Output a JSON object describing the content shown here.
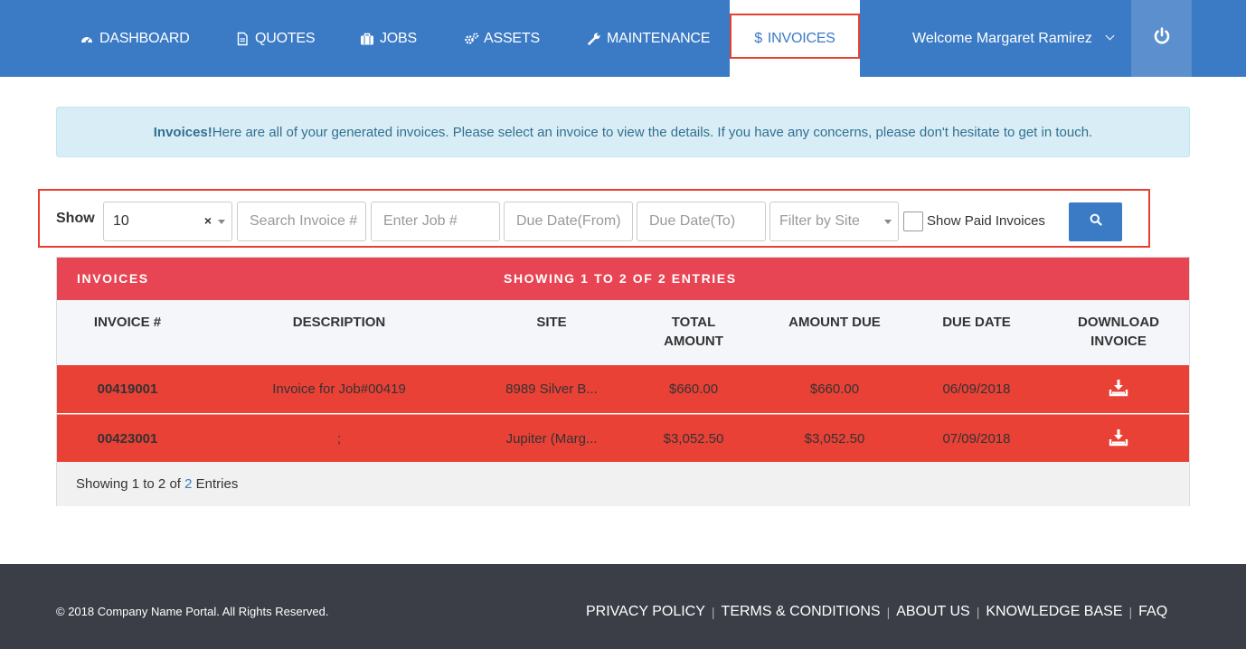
{
  "nav": {
    "items": [
      {
        "label": "DASHBOARD",
        "icon": "dashboard-icon"
      },
      {
        "label": "QUOTES",
        "icon": "file-icon"
      },
      {
        "label": "JOBS",
        "icon": "briefcase-icon"
      },
      {
        "label": "ASSETS",
        "icon": "cogs-icon"
      },
      {
        "label": "MAINTENANCE",
        "icon": "wrench-icon"
      },
      {
        "label": "INVOICES",
        "icon": "dollar-icon",
        "active": true
      }
    ],
    "welcome": "Welcome Margaret Ramirez",
    "power_icon": "power-icon"
  },
  "alert": {
    "bold": "Invoices!",
    "text": "Here are all of your generated invoices. Please select an invoice to view the details. If you have any concerns, please don't hesitate to get in touch."
  },
  "filters": {
    "show_label": "Show",
    "page_length": "10",
    "clear_symbol": "×",
    "search_invoice_placeholder": "Search Invoice #",
    "job_placeholder": "Enter Job #",
    "due_from_placeholder": "Due Date(From)",
    "due_to_placeholder": "Due Date(To)",
    "site_placeholder": "Filter by Site",
    "show_paid_label": "Show Paid Invoices",
    "show_paid_checked": false
  },
  "table": {
    "title": "INVOICES",
    "showing_header": "SHOWING 1 TO 2 OF 2 ENTRIES",
    "columns": {
      "invoice": "INVOICE #",
      "description": "DESCRIPTION",
      "site": "SITE",
      "total_line1": "TOTAL",
      "total_line2": "AMOUNT",
      "amount_due": "AMOUNT DUE",
      "due_date": "DUE DATE",
      "download_line1": "DOWNLOAD",
      "download_line2": "INVOICE"
    },
    "rows": [
      {
        "invoice": "00419001",
        "description": "Invoice for Job#00419",
        "site": "8989 Silver B...",
        "total": "$660.00",
        "amount_due": "$660.00",
        "due_date": "06/09/2018"
      },
      {
        "invoice": "00423001",
        "description": ";",
        "site": "Jupiter (Marg...",
        "total": "$3,052.50",
        "amount_due": "$3,052.50",
        "due_date": "07/09/2018"
      }
    ],
    "footer": {
      "showing": "Showing",
      "from": "1",
      "to_word": "to",
      "to": "2",
      "of_word": "of",
      "total": "2",
      "entries": "Entries"
    }
  },
  "footer": {
    "copyright": "© 2018 Company Name Portal. All Rights Reserved.",
    "links": [
      "PRIVACY POLICY",
      "TERMS & CONDITIONS",
      "ABOUT US",
      "KNOWLEDGE BASE",
      "FAQ"
    ],
    "separator": "|"
  },
  "colors": {
    "nav_bg": "#3b7bc5",
    "row_red": "#e94136",
    "header_red": "#e84554",
    "footer_bg": "#3b3e47",
    "highlight_border": "#e8402f"
  }
}
